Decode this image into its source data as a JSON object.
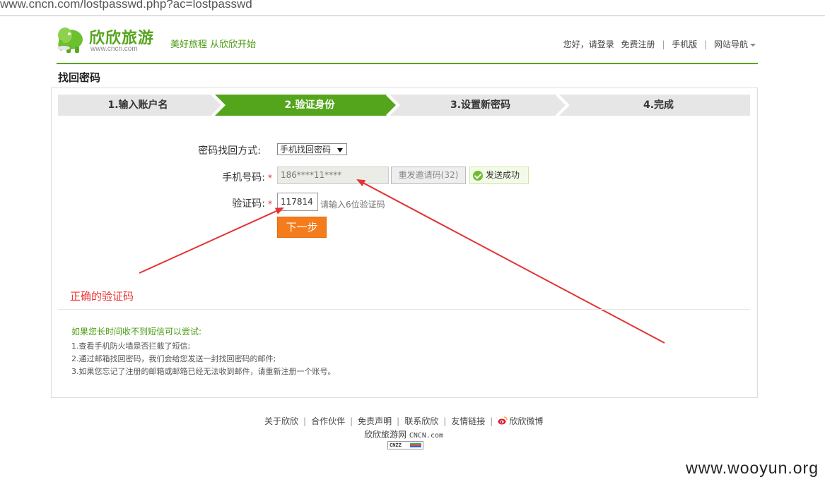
{
  "browser": {
    "url": "www.cncn.com/lostpasswd.php?ac=lostpasswd"
  },
  "header": {
    "brand": "欣欣旅游",
    "domain": "www.cncn.com",
    "slogan": "美好旅程 从欣欣开始",
    "nav": {
      "greeting": "您好，",
      "login": "请登录",
      "register": "免费注册",
      "mobile": "手机版",
      "site_nav": "网站导航"
    }
  },
  "page": {
    "title": "找回密码"
  },
  "steps": [
    {
      "label": "1.输入账户名",
      "active": false
    },
    {
      "label": "2.验证身份",
      "active": true
    },
    {
      "label": "3.设置新密码",
      "active": false
    },
    {
      "label": "4.完成",
      "active": false
    }
  ],
  "form": {
    "method_label": "密码找回方式:",
    "method_value": "手机找回密码",
    "phone_label": "手机号码:",
    "required_mark": "*",
    "phone_value": "186****11****",
    "resend_label": "重发邀请码(32)",
    "success_label": "发送成功",
    "code_label": "验证码:",
    "code_value": "117814",
    "code_hint": "请输入6位验证码",
    "next_label": "下一步"
  },
  "annotation": {
    "text": "正确的验证码",
    "color": "#e33333"
  },
  "tips": {
    "title": "如果您长时间收不到短信可以尝试:",
    "items": [
      "1.查看手机防火墙是否拦截了短信;",
      "2.通过邮箱找回密码，我们会给您发送一封找回密码的邮件;",
      "3.如果您忘记了注册的邮箱或邮箱已经无法收到邮件，请重新注册一个账号。"
    ]
  },
  "footer": {
    "links": [
      "关于欣欣",
      "合作伙伴",
      "免责声明",
      "联系欣欣",
      "友情链接",
      "欣欣微博"
    ],
    "copyright_cn": "欣欣旅游网",
    "copyright_en": "CNCN.com",
    "badge": "CNZZ"
  },
  "watermark": "www.wooyun.org",
  "colors": {
    "brand_green": "#55a51c",
    "step_active": "#55a51c",
    "step_inactive": "#e6e6e6",
    "button_orange": "#f47c1c"
  }
}
